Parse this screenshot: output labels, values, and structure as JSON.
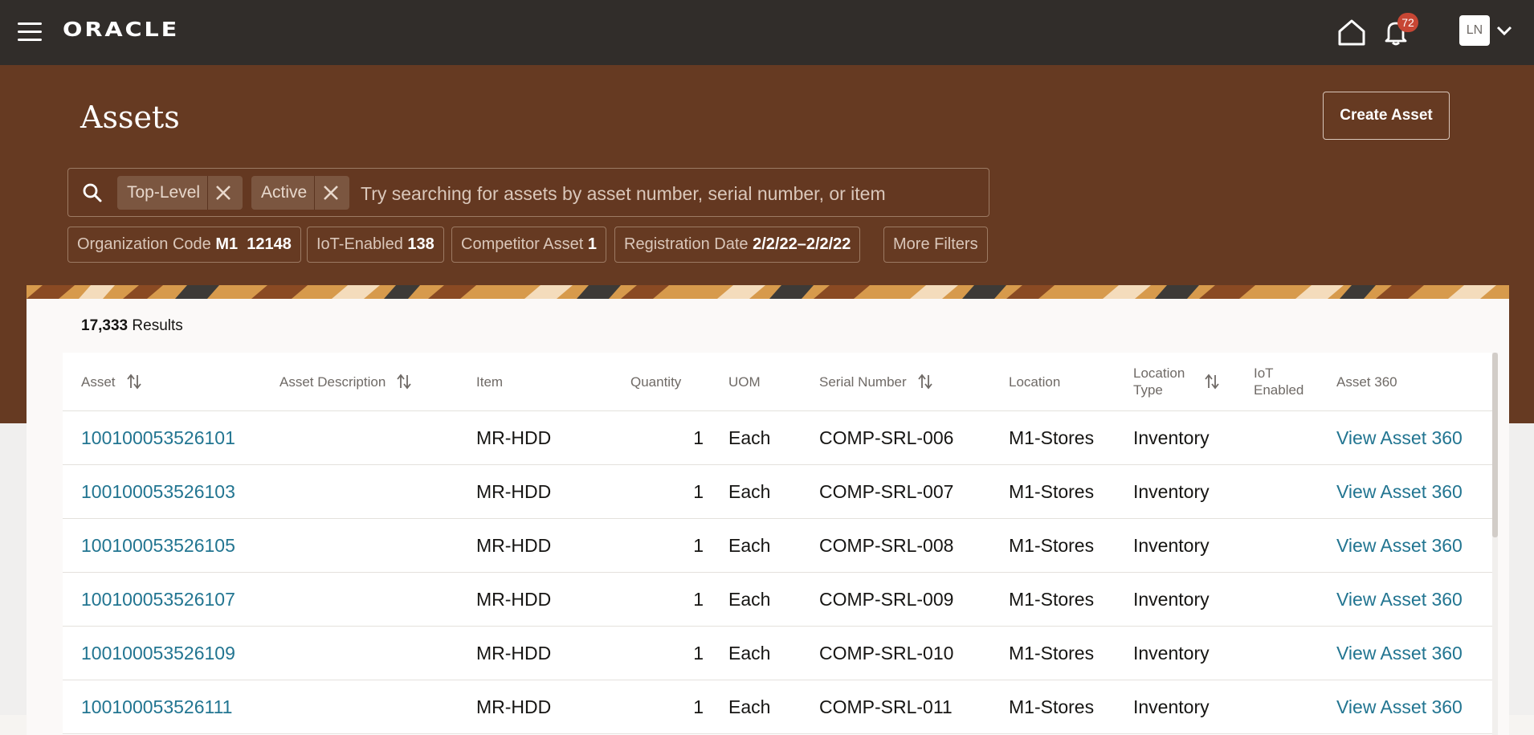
{
  "topbar": {
    "logo": "ORACLE",
    "notification_count": "72",
    "avatar_initials": "LN"
  },
  "page": {
    "title": "Assets",
    "create_button": "Create Asset"
  },
  "search": {
    "placeholder": "Try searching for assets by asset number, serial number, or item",
    "chips": [
      "Top-Level",
      "Active"
    ]
  },
  "filters": [
    {
      "label": "Organization Code",
      "value": "M1  12148"
    },
    {
      "label": "IoT-Enabled",
      "value": "138"
    },
    {
      "label": "Competitor Asset",
      "value": "1"
    },
    {
      "label": "Registration Date",
      "value": "2/2/22–2/2/22"
    },
    {
      "label": "More Filters",
      "value": ""
    }
  ],
  "results": {
    "count": "17,333",
    "label": "Results"
  },
  "table": {
    "columns": [
      "Asset",
      "Asset Description",
      "Item",
      "Quantity",
      "UOM",
      "Serial Number",
      "Location",
      "Location Type",
      "IoT Enabled",
      "Asset 360"
    ],
    "rows": [
      {
        "asset": "100100053526101",
        "description": "",
        "item": "MR-HDD",
        "quantity": "1",
        "uom": "Each",
        "serial": "COMP-SRL-006",
        "location": "M1-Stores",
        "location_type": "Inventory",
        "iot": "",
        "asset360": "View Asset 360"
      },
      {
        "asset": "100100053526103",
        "description": "",
        "item": "MR-HDD",
        "quantity": "1",
        "uom": "Each",
        "serial": "COMP-SRL-007",
        "location": "M1-Stores",
        "location_type": "Inventory",
        "iot": "",
        "asset360": "View Asset 360"
      },
      {
        "asset": "100100053526105",
        "description": "",
        "item": "MR-HDD",
        "quantity": "1",
        "uom": "Each",
        "serial": "COMP-SRL-008",
        "location": "M1-Stores",
        "location_type": "Inventory",
        "iot": "",
        "asset360": "View Asset 360"
      },
      {
        "asset": "100100053526107",
        "description": "",
        "item": "MR-HDD",
        "quantity": "1",
        "uom": "Each",
        "serial": "COMP-SRL-009",
        "location": "M1-Stores",
        "location_type": "Inventory",
        "iot": "",
        "asset360": "View Asset 360"
      },
      {
        "asset": "100100053526109",
        "description": "",
        "item": "MR-HDD",
        "quantity": "1",
        "uom": "Each",
        "serial": "COMP-SRL-010",
        "location": "M1-Stores",
        "location_type": "Inventory",
        "iot": "",
        "asset360": "View Asset 360"
      },
      {
        "asset": "100100053526111",
        "description": "",
        "item": "MR-HDD",
        "quantity": "1",
        "uom": "Each",
        "serial": "COMP-SRL-011",
        "location": "M1-Stores",
        "location_type": "Inventory",
        "iot": "",
        "asset360": "View Asset 360"
      }
    ]
  },
  "colors": {
    "topbar_bg": "#312d2a",
    "header_bg": "#663a22",
    "link": "#227591",
    "badge": "#c74634"
  },
  "icons": [
    "hamburger-icon",
    "home-icon",
    "bell-icon",
    "chevron-down-icon",
    "search-icon",
    "close-icon",
    "sort-icon"
  ]
}
